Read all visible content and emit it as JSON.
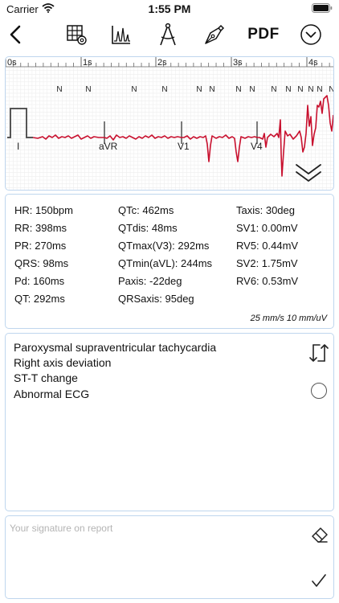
{
  "status_bar": {
    "carrier": "Carrier",
    "time": "1:55 PM"
  },
  "toolbar": {
    "back": "chevron-left-icon",
    "grid_settings": "grid-settings-icon",
    "ecg_chart": "ecg-chart-icon",
    "compass": "compass-icon",
    "pen": "fountain-pen-icon",
    "pdf_label": "PDF",
    "more": "chevron-down-circle-icon"
  },
  "ecg": {
    "time_labels": [
      "0s",
      "1s",
      "2s",
      "3s",
      "4s"
    ],
    "beat_marks": [
      "N",
      "N",
      "N",
      "N",
      "N",
      "N",
      "N",
      "N",
      "N",
      "N",
      "N",
      "N",
      "N",
      "N"
    ],
    "lead_labels": [
      "I",
      "aVR",
      "V1",
      "V4"
    ],
    "trace_color": "#c8102e",
    "calibration_color": "#555555",
    "grid_color": "#eeeeee",
    "expand_icon": "double-chevron-down-icon"
  },
  "metrics": {
    "col1": [
      "HR: 150bpm",
      "RR: 398ms",
      "PR: 270ms",
      "QRS: 98ms",
      "Pd: 160ms",
      "QT: 292ms"
    ],
    "col2": [
      "QTc: 462ms",
      "QTdis: 48ms",
      "QTmax(V3): 292ms",
      "QTmin(aVL): 244ms",
      "Paxis: -22deg",
      "QRSaxis: 95deg"
    ],
    "col3": [
      "Taxis: 30deg",
      "SV1: 0.00mV",
      "RV5: 0.44mV",
      "SV2: 1.75mV",
      "RV6: 0.53mV"
    ],
    "speed": "25 mm/s  10 mm/uV"
  },
  "diagnosis": {
    "items": [
      "Paroxysmal supraventricular tachycardia",
      "Right axis deviation",
      "ST-T change",
      "Abnormal ECG"
    ],
    "swap_icon": "swap-icon",
    "radio_icon": "radio-unchecked-icon"
  },
  "signature": {
    "placeholder": "Your signature on report",
    "eraser_icon": "eraser-icon",
    "confirm_icon": "checkmark-icon"
  }
}
